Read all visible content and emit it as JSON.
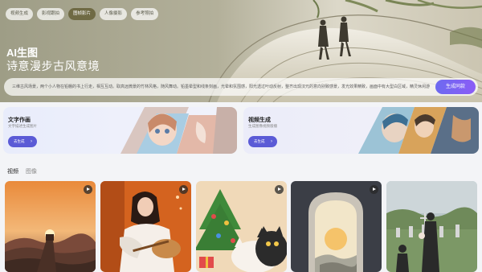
{
  "top_tabs": [
    {
      "label": "视频生成"
    },
    {
      "label": "影视跟拍"
    },
    {
      "label": "图帧影片"
    },
    {
      "label": "人像摄影"
    },
    {
      "label": "参考照拍"
    }
  ],
  "hero": {
    "title": "AI生图",
    "subtitle": "诗意漫步古风意境",
    "prompt": "三维古风场景，两个小人物在铅棚的书上行走，相互互动。取高远微景的竹林风格，随风舞动。铅墨晕型和线条刻画，光晕和氛围感，阳光透过叶动反射，整齐出现汉元的意向别致感景，发光效果精致，画面中有大型白区域，精灵休闲游览",
    "generate_button": "生成同款"
  },
  "feature_cards": [
    {
      "title": "文字作画",
      "subtitle": "文字描述生成图片",
      "button": "去生成"
    },
    {
      "title": "视频生成",
      "subtitle": "生成图像视频版播",
      "button": "去生成"
    }
  ],
  "media_tabs": [
    {
      "label": "视频"
    },
    {
      "label": "图像"
    }
  ],
  "icons": {
    "play": "play-icon",
    "arrow": "arrow-right-icon"
  },
  "colors": {
    "accent": "#5b5bd6",
    "active_tab": "#6f6a44"
  }
}
